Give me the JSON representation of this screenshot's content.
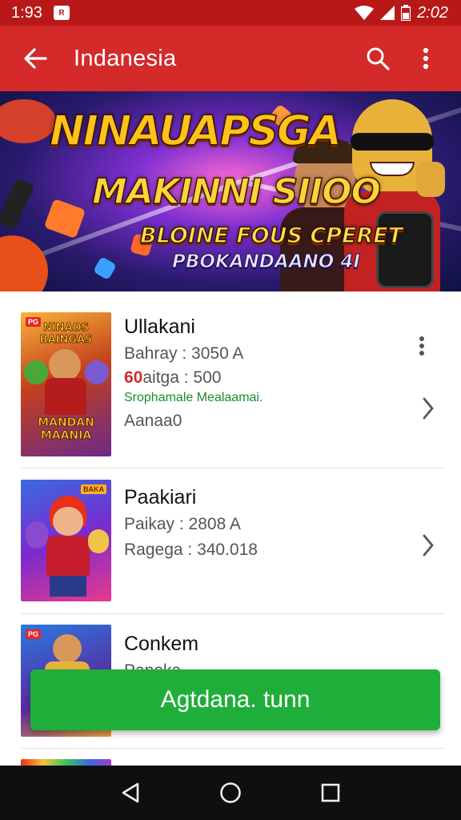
{
  "status_bar": {
    "time": "1:93",
    "notification_badge": "R",
    "battery_time": "2:02"
  },
  "app_bar": {
    "title": "Indanesia",
    "back_icon": "arrow-left-icon",
    "search_icon": "search-icon",
    "more_icon": "more-vertical-icon"
  },
  "banner": {
    "line1": "NINAUAPSGA",
    "line2": "MAKINNI SIIOO",
    "line3": "BLOINE FOUS CPERET",
    "line4": "PBOKANDAANO 4I"
  },
  "items": [
    {
      "title": "Ullakani",
      "line1": "Bahray : 3050 A",
      "line2_prefix": "60",
      "line2_rest": "aitga : 500",
      "green": "Srophamale Mealaamai.",
      "line3": "Aanaa0",
      "thumb_top": "NINAOS BAINGAS",
      "thumb_bottom": "MANDAN MAANIA",
      "badge": "PG"
    },
    {
      "title": "Paakiari",
      "line1": "Paikay : 2808 A",
      "line2": "Ragega : 340.018",
      "thumb_badge": "BAKA"
    },
    {
      "title": "Conkem",
      "line1": "Paneka",
      "thumb_badge": "PG"
    }
  ],
  "cta": {
    "label": "Agtdana. tunn"
  },
  "colors": {
    "status_bar": "#b81818",
    "app_bar": "#d42a2a",
    "cta": "#1fae3a",
    "nav_bar": "#0f0f0f"
  }
}
